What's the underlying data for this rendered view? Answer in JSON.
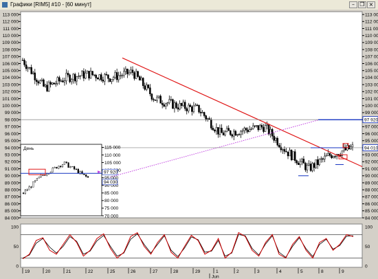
{
  "window": {
    "title": "Графики [RIM5] #10 - [60 минут]",
    "minimize_glyph": "–",
    "restore_glyph": "❐",
    "close_glyph": "×"
  },
  "colors": {
    "background": "#ffffff",
    "window_frame": "#d4d0c8",
    "candle": "#000000",
    "trend_line": "#e01818",
    "trend_dotted": "#c040e0",
    "level_line": "#1030c0",
    "highlight_box": "#e01818",
    "oscillator_main": "#cc0000",
    "oscillator_signal": "#000000",
    "price_box_fill": "#ffffff"
  },
  "chart_data": [
    {
      "type": "candlestick",
      "title": "",
      "y_axis_ticks": [
        "113 000",
        "112 000",
        "111 000",
        "110 000",
        "109 000",
        "108 000",
        "107 000",
        "106 000",
        "105 000",
        "104 000",
        "103 000",
        "102 000",
        "101 000",
        "100 000",
        "99 000",
        "98 000",
        "97 000",
        "96 000",
        "95 000",
        "94 000",
        "93 000",
        "92 000",
        "91 000",
        "90 000",
        "89 000",
        "88 000",
        "87 000",
        "86 000",
        "85 000",
        "84 000"
      ],
      "ylim": [
        84000,
        113400
      ],
      "x_axis_ticks": [
        "19",
        "20",
        "21",
        "22",
        "25",
        "26",
        "27",
        "28",
        "29",
        "1",
        "2",
        "3",
        "4",
        "5",
        "8",
        "9"
      ],
      "x_axis_month": "Jun",
      "grid": false,
      "close_series_approx": [
        {
          "x": "19",
          "close": 106500
        },
        {
          "x": "20",
          "close": 102500
        },
        {
          "x": "21",
          "close": 104000
        },
        {
          "x": "22",
          "close": 104500
        },
        {
          "x": "25",
          "close": 104000
        },
        {
          "x": "26",
          "close": 104800
        },
        {
          "x": "27",
          "close": 101000
        },
        {
          "x": "28",
          "close": 100000
        },
        {
          "x": "29",
          "close": 99500
        },
        {
          "x": "1",
          "close": 96000
        },
        {
          "x": "2",
          "close": 96500
        },
        {
          "x": "3",
          "close": 97000
        },
        {
          "x": "4",
          "close": 93500
        },
        {
          "x": "5",
          "close": 91000
        },
        {
          "x": "8",
          "close": 93000
        },
        {
          "x": "9",
          "close": 94000
        }
      ],
      "levels": [
        98000,
        94000
      ],
      "price_labels": [
        "97 920",
        "94 010"
      ]
    },
    {
      "type": "candlestick",
      "title": "День",
      "y_axis_ticks": [
        "115 000",
        "110 000",
        "105 000",
        "100 000",
        "95 000",
        "90 000",
        "85 000",
        "80 000",
        "75 000",
        "70 000"
      ],
      "ylim": [
        70000,
        117000
      ],
      "level": 97920,
      "price_labels": [
        "97 920",
        "94 030"
      ]
    },
    {
      "type": "line",
      "title": "",
      "y_axis_ticks": [
        "100",
        "50",
        "0"
      ],
      "ylim": [
        0,
        100
      ],
      "levels": [
        80,
        20
      ],
      "series": [
        {
          "values": [
            18,
            30,
            65,
            72,
            40,
            30,
            55,
            80,
            60,
            25,
            40,
            70,
            82,
            45,
            20,
            35,
            75,
            85,
            50,
            30,
            60,
            80,
            35,
            20,
            50,
            78,
            65,
            30,
            40,
            70,
            20,
            35,
            85,
            75,
            40,
            25,
            60,
            80,
            30,
            20,
            55,
            75,
            40,
            20,
            60,
            70,
            40,
            55,
            80,
            75
          ]
        },
        {
          "values": [
            20,
            28,
            58,
            70,
            48,
            33,
            50,
            75,
            63,
            30,
            38,
            64,
            78,
            50,
            25,
            33,
            68,
            82,
            55,
            33,
            55,
            77,
            40,
            24,
            46,
            74,
            67,
            35,
            38,
            65,
            25,
            33,
            80,
            77,
            45,
            28,
            56,
            77,
            35,
            22,
            50,
            72,
            44,
            24,
            55,
            68,
            43,
            52,
            76,
            77
          ]
        }
      ]
    }
  ]
}
